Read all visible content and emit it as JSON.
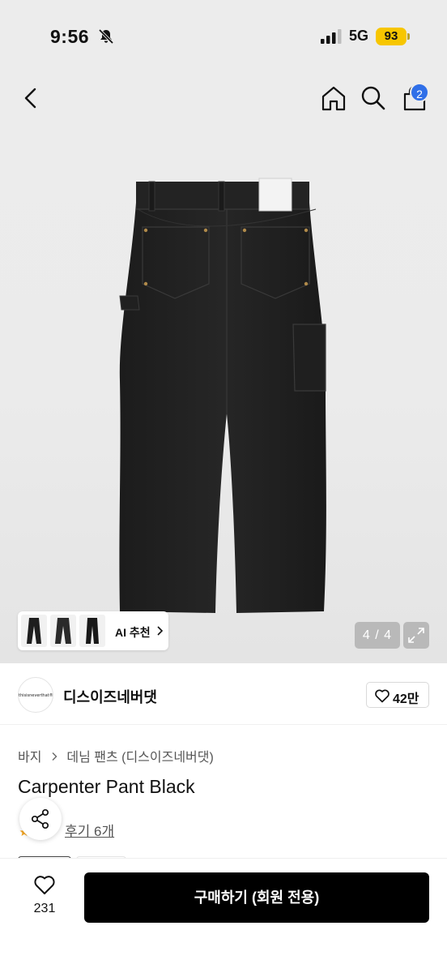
{
  "status_bar": {
    "time": "9:56",
    "network": "5G",
    "battery": "93"
  },
  "nav": {
    "cart_count": "2"
  },
  "gallery": {
    "ai_label": "AI 추천",
    "counter": "4 / 4"
  },
  "brand": {
    "logo_text": "thisisneverthat®",
    "name": "디스이즈네버댓",
    "likes": "42만"
  },
  "breadcrumb": [
    "바지",
    "데님 팬츠 (디스이즈네버댓)"
  ],
  "product": {
    "title": "Carpenter Pant Black",
    "reviews": "후기 6개"
  },
  "bottom_bar": {
    "wish_count": "231",
    "buy_label": "구매하기 (회원 전용)"
  },
  "colors": {
    "accent_badge": "#2f6fe8",
    "battery": "#f7c600",
    "buy_button": "#000000",
    "background": "#ececec"
  },
  "icons": [
    "back-icon",
    "home-icon",
    "search-icon",
    "cart-icon",
    "bell-slash-icon",
    "expand-icon",
    "heart-icon",
    "share-icon"
  ]
}
